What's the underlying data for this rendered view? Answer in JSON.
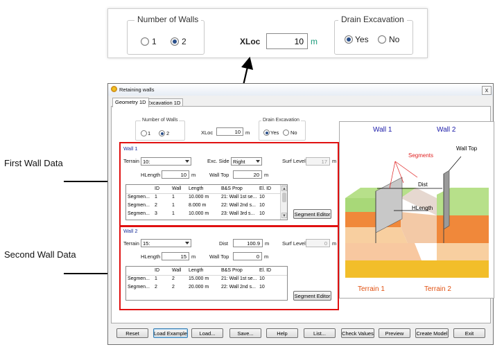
{
  "zoom": {
    "walls_legend": "Number of Walls",
    "walls_opt1": "1",
    "walls_opt2": "2",
    "xloc_label": "XLoc",
    "xloc_value": "10",
    "unit": "m",
    "drain_legend": "Drain Excavation",
    "drain_yes": "Yes",
    "drain_no": "No"
  },
  "annotations": {
    "first": "First Wall Data",
    "second": "Second Wall Data"
  },
  "window": {
    "title": "Retaining walls",
    "close": "x",
    "tabs": [
      "Geometry 1D",
      "Excavation 1D"
    ]
  },
  "top": {
    "walls_legend": "Number of Walls",
    "walls_opt1": "1",
    "walls_opt2": "2",
    "xloc_label": "XLoc",
    "xloc_value": "10",
    "unit": "m",
    "drain_legend": "Drain Excavation",
    "drain_yes": "Yes",
    "drain_no": "No"
  },
  "wall1": {
    "title": "Wall 1",
    "terrain_label": "Terrain",
    "terrain_value": "10:",
    "exc_side_label": "Exc. Side",
    "exc_side_value": "Right",
    "surf_level_label": "Surf Level",
    "surf_level_value": "17",
    "hlength_label": "HLength",
    "hlength_value": "10",
    "walltop_label": "Wall Top",
    "walltop_value": "20",
    "unit": "m",
    "columns": [
      "ID",
      "Wall",
      "Length",
      "B&S Prop",
      "El. ID"
    ],
    "rows": [
      [
        "Segmen...",
        "1",
        "1",
        "10.000 m",
        "21: Wall 1st se...",
        "10"
      ],
      [
        "Segmen...",
        "2",
        "1",
        "8.000 m",
        "22: Wall 2nd s...",
        "10"
      ],
      [
        "Segmen...",
        "3",
        "1",
        "10.000 m",
        "23: Wall 3rd s...",
        "10"
      ]
    ],
    "segment_editor": "Segment Editor"
  },
  "wall2": {
    "title": "Wall 2",
    "terrain_label": "Terrain",
    "terrain_value": "15:",
    "dist_label": "Dist",
    "dist_value": "100.9",
    "surf_level_label": "Surf Level",
    "surf_level_value": "0",
    "hlength_label": "HLength",
    "hlength_value": "15",
    "walltop_label": "Wall Top",
    "walltop_value": "0",
    "unit": "m",
    "columns": [
      "ID",
      "Wall",
      "Length",
      "B&S Prop",
      "El. ID"
    ],
    "rows": [
      [
        "Segmen...",
        "1",
        "2",
        "15.000 m",
        "21: Wall 1st se...",
        "10"
      ],
      [
        "Segmen...",
        "2",
        "2",
        "20.000 m",
        "22: Wall 2nd s...",
        "10"
      ]
    ],
    "segment_editor": "Segment Editor"
  },
  "picture": {
    "wall1": "Wall 1",
    "wall2": "Wall 2",
    "segments": "Segments",
    "walltop": "Wall Top",
    "dist": "Dist",
    "hlength": "HLength",
    "terrain1": "Terrain 1",
    "terrain2": "Terrain 2",
    "colors": {
      "wall_label": "#1a1aa8",
      "accent_label": "#e02020",
      "terrain_label": "#e05010"
    }
  },
  "buttons": [
    "Reset",
    "Load Example",
    "Load...",
    "Save...",
    "Help",
    "List...",
    "Check Values",
    "Preview",
    "Create Model",
    "Exit"
  ]
}
